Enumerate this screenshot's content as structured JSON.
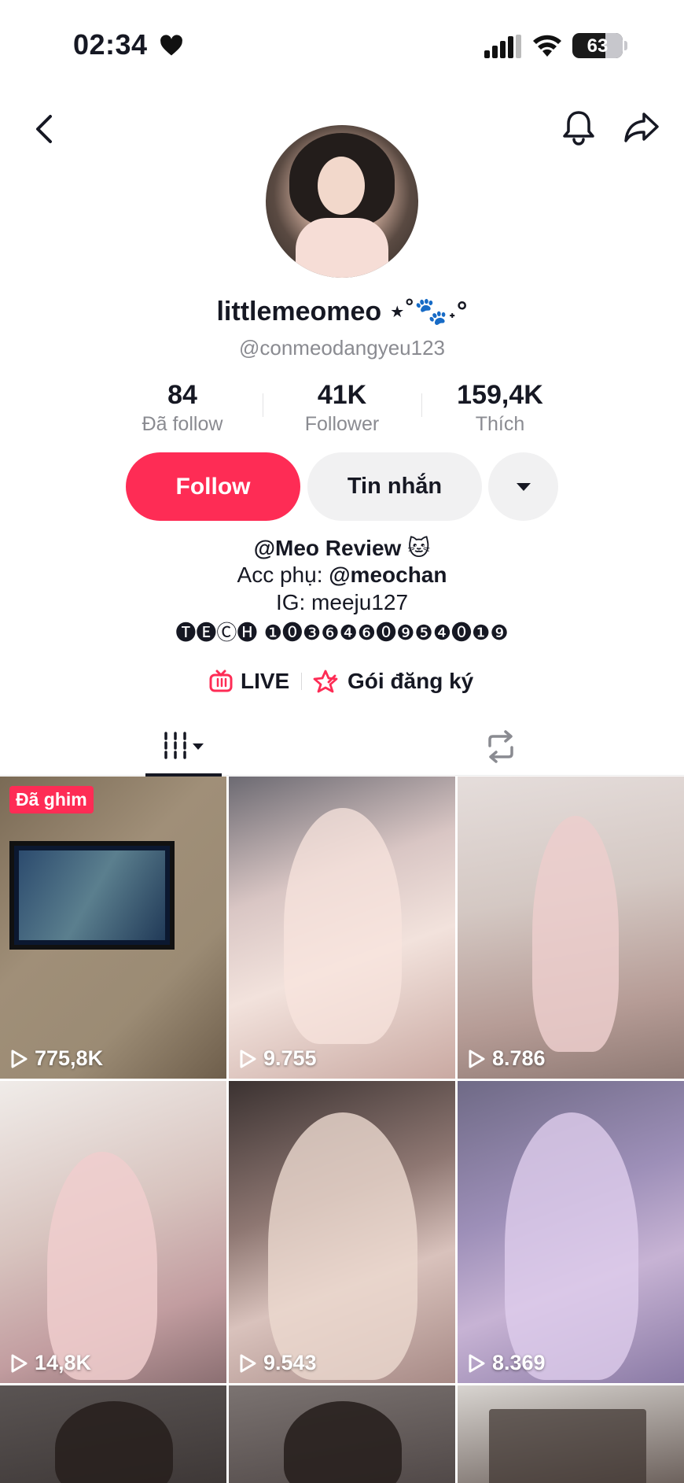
{
  "status_bar": {
    "time": "02:34",
    "battery": "63",
    "battery_level": 0.63
  },
  "profile": {
    "display_name": "littlemeomeo ⋆˚🐾˖°",
    "username": "@conmeodangyeu123",
    "stats": [
      {
        "value": "84",
        "label": "Đã follow"
      },
      {
        "value": "41K",
        "label": "Follower"
      },
      {
        "value": "159,4K",
        "label": "Thích"
      }
    ],
    "follow_label": "Follow",
    "message_label": "Tin nhắn",
    "bio": {
      "line1": "@Meo Review 🐱",
      "line2_prefix": "Acc phụ: ",
      "line2_handle": "@meochan",
      "line3": "IG: meeju127",
      "line4": "🅣🅔Ⓒ🅗 ❶⓿❸❻❹❻⓿❾❺❹⓿❶❾"
    },
    "links": {
      "live": "LIVE",
      "subscription": "Gói đăng ký"
    }
  },
  "videos": {
    "pinned_label": "Đã ghim",
    "items": [
      {
        "views": "775,8K",
        "pinned": true
      },
      {
        "views": "9.755"
      },
      {
        "views": "8.786"
      },
      {
        "views": "14,8K"
      },
      {
        "views": "9.543"
      },
      {
        "views": "8.369"
      },
      {
        "views": ""
      },
      {
        "views": ""
      },
      {
        "views": ""
      }
    ]
  },
  "colors": {
    "accent": "#fe2c55",
    "secondary_bg": "#f1f1f2",
    "text_primary": "#161823",
    "text_secondary": "#8a8b91"
  },
  "icons": {
    "back": "chevron-left-icon",
    "bell": "bell-icon",
    "share": "share-arrow-icon",
    "dropdown": "caret-down-icon",
    "live": "live-tv-icon",
    "subscription": "subscription-star-icon",
    "videos_tab": "grid-columns-icon",
    "reposts_tab": "repost-icon",
    "play": "play-icon"
  }
}
